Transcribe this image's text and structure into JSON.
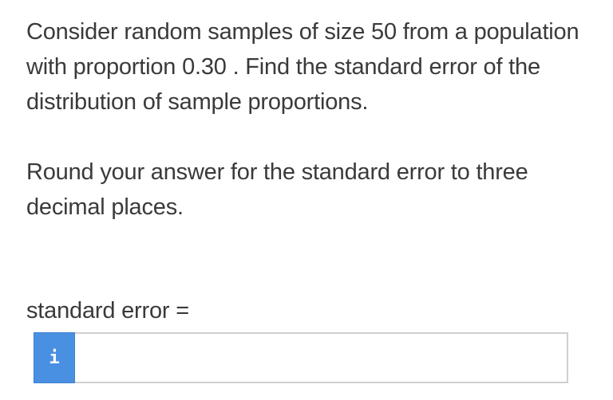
{
  "question": {
    "paragraph1": "Consider random samples of size 50 from a population with proportion 0.30 . Find the standard error of the distribution of sample proportions.",
    "paragraph2": "Round your answer for the standard error to three decimal places."
  },
  "answer": {
    "label": "standard error =",
    "value": "",
    "info_button_label": "i",
    "info_icon": "info-icon"
  },
  "colors": {
    "accent": "#4a90e2",
    "text": "#3a3a3a",
    "input_border": "#d0d0d0"
  }
}
